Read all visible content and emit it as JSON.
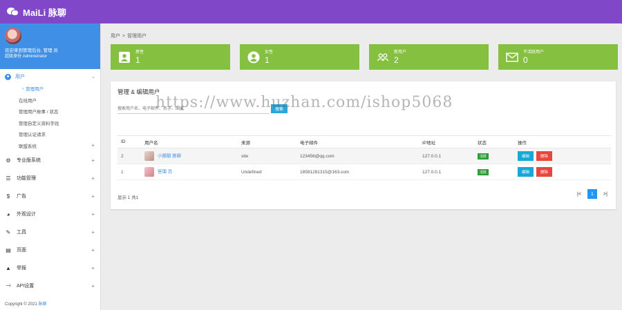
{
  "app": {
    "brand": "MaiLi 脉聊"
  },
  "sidebar": {
    "welcome": "欢迎来到管理后台, 管理 员",
    "role": "超级身份 Administrator",
    "group": {
      "label": "用户",
      "chevron": "⌄"
    },
    "sub_items": [
      {
        "label": "管理用户",
        "active": true
      },
      {
        "label": "在线用户"
      },
      {
        "label": "管理用户故事 / 状态"
      },
      {
        "label": "管理自定义资料字段"
      },
      {
        "label": "管理认证请求"
      },
      {
        "label": "联盟系统",
        "expandable": true
      }
    ],
    "items": [
      {
        "label": "专业版系统",
        "icon": "gear-icon"
      },
      {
        "label": "功能管理",
        "icon": "list-icon"
      },
      {
        "label": "广告",
        "icon": "dollar-icon"
      },
      {
        "label": "外观设计",
        "icon": "palette-icon"
      },
      {
        "label": "工具",
        "icon": "wrench-icon"
      },
      {
        "label": "页面",
        "icon": "page-icon"
      },
      {
        "label": "举报",
        "icon": "warning-icon"
      },
      {
        "label": "API设置",
        "icon": "api-icon"
      }
    ],
    "footer_text": "Copyright © 2021 ",
    "footer_link": "脉聊"
  },
  "breadcrumb": {
    "parent": "用户",
    "separator": ">",
    "current": "管理用户"
  },
  "stats": [
    {
      "label": "男性",
      "value": "1",
      "icon": "male-user-icon"
    },
    {
      "label": "女性",
      "value": "1",
      "icon": "female-user-icon"
    },
    {
      "label": "新用户",
      "value": "2",
      "icon": "users-icon"
    },
    {
      "label": "不活跃用户",
      "value": "0",
      "icon": "mail-icon"
    }
  ],
  "panel": {
    "title": "管理 & 编辑用户",
    "search_placeholder": "搜索用户名、电子邮件、名字、国家",
    "search_button": "搜索"
  },
  "table": {
    "headers": [
      "ID",
      "用户名",
      "来源",
      "电子邮件",
      "IP地址",
      "状态",
      "操作"
    ],
    "rows": [
      {
        "id": "2",
        "username": "小甜甜 脉聊",
        "source": "site",
        "email": "123456@qq.com",
        "ip": "127.0.0.1",
        "status": "活跃",
        "edit": "编辑",
        "delete": "删除"
      },
      {
        "id": "1",
        "username": "管理 员",
        "source": "Undefined",
        "email": "18581281315@163.com",
        "ip": "127.0.0.1",
        "status": "活跃",
        "edit": "编辑",
        "delete": "删除"
      }
    ]
  },
  "pagination": {
    "showing": "显示 1 共1",
    "first": "|<",
    "current": "1",
    "last": ">|"
  },
  "watermark": "https://www.huzhan.com/ishop5068",
  "colors": {
    "topbar": "#8048c8",
    "profile": "#3f8fe6",
    "stat": "#86c040",
    "edit": "#18a7d9",
    "delete": "#e8453c",
    "status": "#2e9a3a"
  }
}
